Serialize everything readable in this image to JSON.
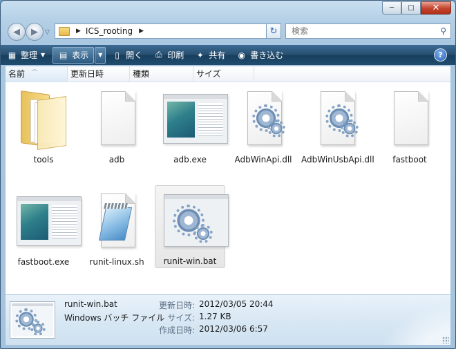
{
  "window": {
    "caption_buttons": {
      "minimize": "─",
      "maximize": "□",
      "close": "✕"
    }
  },
  "nav": {
    "back_glyph": "◀",
    "forward_glyph": "▶",
    "breadcrumb": [
      "ICS_rooting"
    ],
    "search_placeholder": "検索"
  },
  "toolbar": {
    "organize": "整理",
    "view": "表示",
    "open": "開く",
    "print": "印刷",
    "share": "共有",
    "burn": "書き込む",
    "help": "?"
  },
  "columns": [
    "名前",
    "更新日時",
    "種類",
    "サイズ"
  ],
  "files": [
    {
      "name": "tools",
      "icon": "folder-icon"
    },
    {
      "name": "adb",
      "icon": "blank-file-icon"
    },
    {
      "name": "adb.exe",
      "icon": "application-icon"
    },
    {
      "name": "AdbWinApi.dll",
      "icon": "gear-file-icon"
    },
    {
      "name": "AdbWinUsbApi.dll",
      "icon": "gear-file-icon"
    },
    {
      "name": "fastboot",
      "icon": "blank-file-icon"
    },
    {
      "name": "fastboot.exe",
      "icon": "application-icon"
    },
    {
      "name": "runit-linux.sh",
      "icon": "notepad-file-icon"
    },
    {
      "name": "runit-win.bat",
      "icon": "batch-file-icon",
      "selected": true
    }
  ],
  "details": {
    "name": "runit-win.bat",
    "type": "Windows バッチ ファイル",
    "modified_label": "更新日時:",
    "modified_value": "2012/03/05 20:44",
    "size_label": "サイズ:",
    "size_value": "1.27 KB",
    "created_label": "作成日時:",
    "created_value": "2012/03/06 6:57"
  },
  "colors": {
    "toolbar_top": "#3c6b93",
    "toolbar_bottom": "#183e5d",
    "frame": "#a7c6e0",
    "close_button": "#c3432c"
  }
}
